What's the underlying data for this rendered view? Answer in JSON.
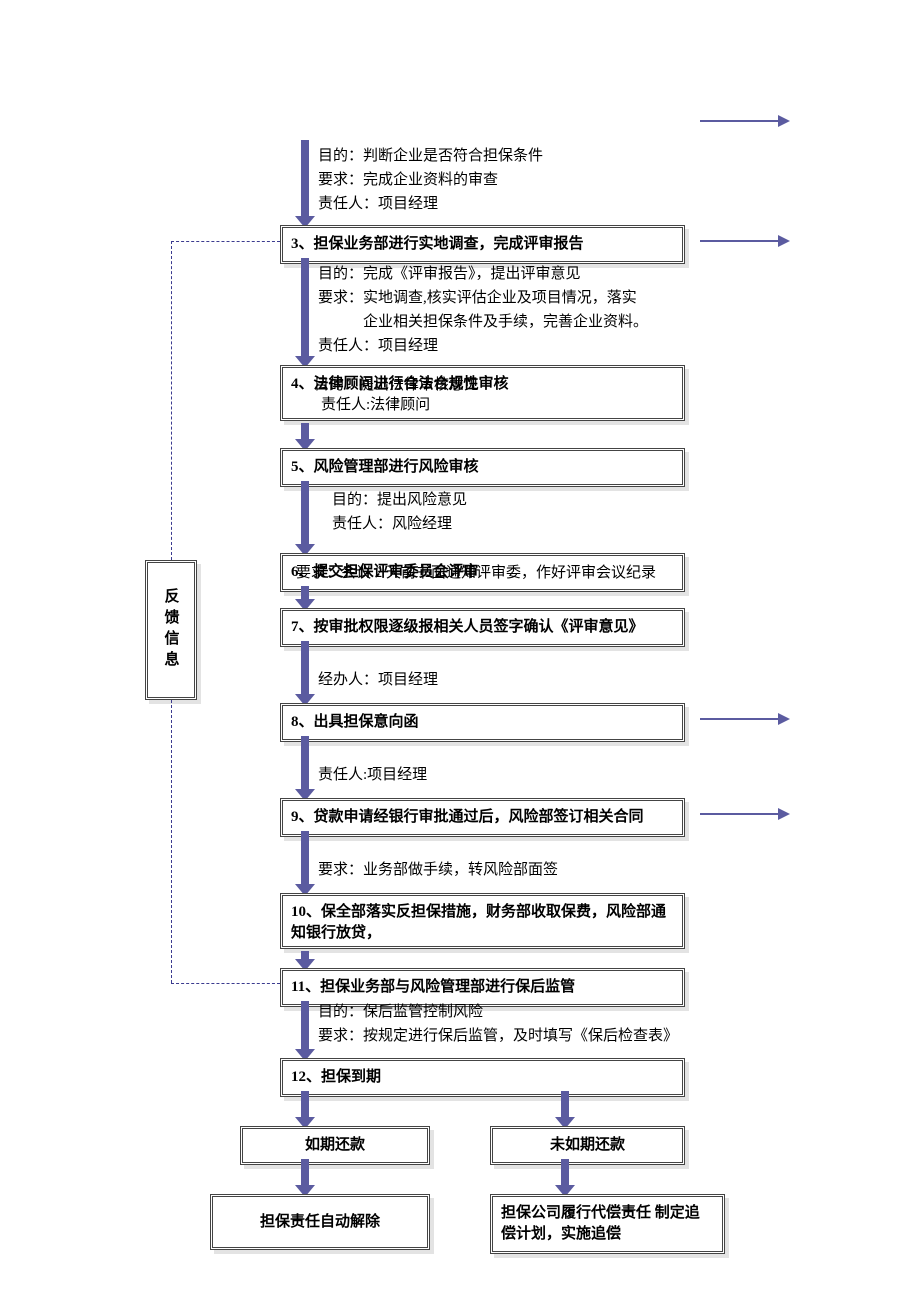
{
  "sidebar": {
    "title": "反馈信息"
  },
  "pre": {
    "l1": "目的：判断企业是否符合担保条件",
    "l2": "要求：完成企业资料的审查",
    "l3": "责任人：项目经理"
  },
  "b3": {
    "title": "3、担保业务部进行实地调查，完成评审报告",
    "l1": "目的：完成《评审报告》，提出评审意见",
    "l2": "要求：实地调查,核实评估企业及项目情况，落实",
    "l3": "            企业相关担保条件及手续，完善企业资料。",
    "l4": "责任人：项目经理"
  },
  "b4": {
    "title": "4、法律顾问进行合法合规性审核",
    "sub1": "目的：提出法律审核意见",
    "sub2": "责任人:法律顾问"
  },
  "b5": {
    "title": "5、风险管理部进行风险审核",
    "l1": "目的：提出风险意见",
    "l2": "责任人：风险经理"
  },
  "b6": {
    "title": "6、提交担保评审委员会评审",
    "sub": "要求：会议 2 天前书面通知评审委，作好评审会议纪录"
  },
  "b7": {
    "title": "7、按审批权限逐级报相关人员签字确认《评审意见》"
  },
  "b8": {
    "pre": "经办人：项目经理",
    "title": "8、出具担保意向函",
    "after": "责任人:项目经理"
  },
  "b9": {
    "title": "9、贷款申请经银行审批通过后，风险部签订相关合同",
    "after": "要求：业务部做手续，转风险部面签"
  },
  "b10": {
    "title": "10、保全部落实反担保措施，财务部收取保费，风险部通知银行放贷，"
  },
  "b11": {
    "title": "11、担保业务部与风险管理部进行保后监管",
    "l1": "目的：保后监管控制风险",
    "l2": "要求：按规定进行保后监管，及时填写《保后检查表》"
  },
  "b12": {
    "title": "12、担保到期"
  },
  "left": {
    "top": "如期还款",
    "bottom": "担保责任自动解除"
  },
  "right": {
    "top": "未如期还款",
    "bottom": "担保公司履行代偿责任\n制定追偿计划，实施追偿"
  }
}
